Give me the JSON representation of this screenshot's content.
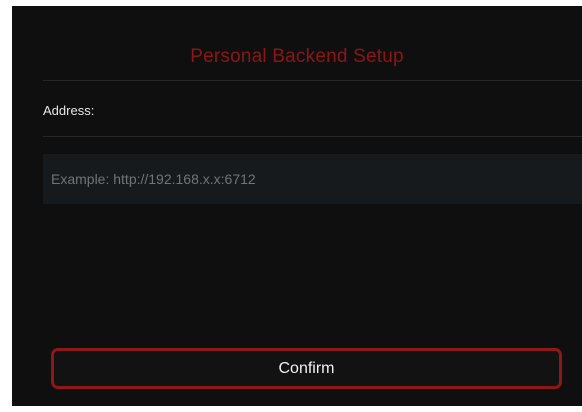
{
  "dialog": {
    "title": "Personal Backend Setup",
    "address_label": "Address:",
    "address_input": {
      "value": "",
      "placeholder": "Example: http://192.168.x.x:6712"
    },
    "confirm_label": "Confirm"
  },
  "colors": {
    "background": "#0f0f0f",
    "accent": "#8e1717",
    "input_background": "#161a1c"
  }
}
